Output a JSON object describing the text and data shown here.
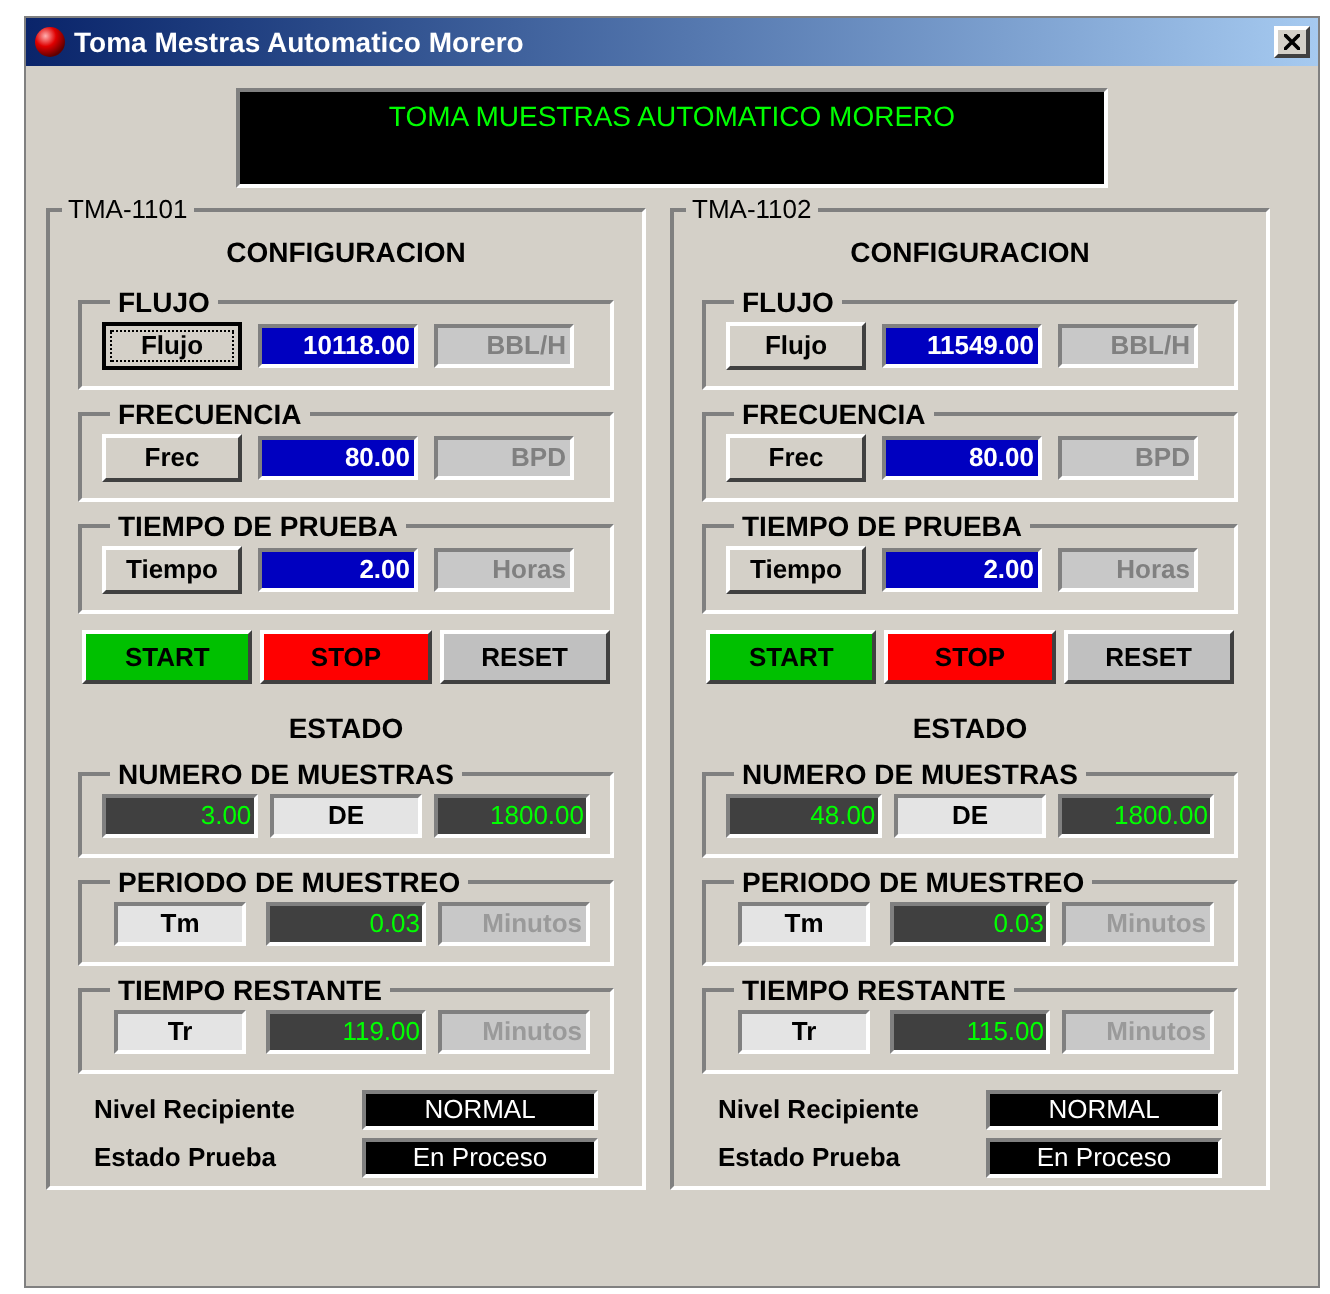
{
  "window": {
    "title": "Toma Mestras Automatico Morero"
  },
  "banner": "TOMA MUESTRAS AUTOMATICO MORERO",
  "panels": [
    {
      "title": "TMA-1101",
      "config_heading": "CONFIGURACION",
      "config_groups": [
        {
          "title": "FLUJO",
          "button": {
            "label": "Flujo",
            "focused": true
          },
          "value": "10118.00",
          "unit": "BBL/H"
        },
        {
          "title": "FRECUENCIA",
          "button": {
            "label": "Frec",
            "focused": false
          },
          "value": "80.00",
          "unit": "BPD"
        },
        {
          "title": "TIEMPO DE PRUEBA",
          "button": {
            "label": "Tiempo",
            "focused": false
          },
          "value": "2.00",
          "unit": "Horas"
        }
      ],
      "actions": [
        {
          "label": "START",
          "kind": "start"
        },
        {
          "label": "STOP",
          "kind": "stop"
        },
        {
          "label": "RESET",
          "kind": "reset"
        }
      ],
      "status_heading": "ESTADO",
      "status_groups": [
        {
          "title": "NUMERO DE MUESTRAS",
          "cells": [
            {
              "text": "3.00",
              "kind": "reading"
            },
            {
              "text": "DE",
              "kind": "label"
            },
            {
              "text": "1800.00",
              "kind": "reading"
            }
          ]
        },
        {
          "title": "PERIODO DE MUESTREO",
          "cells": [
            {
              "text": "Tm",
              "kind": "label"
            },
            {
              "text": "0.03",
              "kind": "reading"
            },
            {
              "text": "Minutos",
              "kind": "unit"
            }
          ]
        },
        {
          "title": "TIEMPO RESTANTE",
          "cells": [
            {
              "text": "Tr",
              "kind": "label"
            },
            {
              "text": "119.00",
              "kind": "reading"
            },
            {
              "text": "Minutos",
              "kind": "unit"
            }
          ]
        }
      ],
      "indicators": [
        {
          "label": "Nivel Recipiente",
          "value": "NORMAL"
        },
        {
          "label": "Estado Prueba",
          "value": "En Proceso"
        }
      ]
    },
    {
      "title": "TMA-1102",
      "config_heading": "CONFIGURACION",
      "config_groups": [
        {
          "title": "FLUJO",
          "button": {
            "label": "Flujo",
            "focused": false
          },
          "value": "11549.00",
          "unit": "BBL/H"
        },
        {
          "title": "FRECUENCIA",
          "button": {
            "label": "Frec",
            "focused": false
          },
          "value": "80.00",
          "unit": "BPD"
        },
        {
          "title": "TIEMPO DE PRUEBA",
          "button": {
            "label": "Tiempo",
            "focused": false
          },
          "value": "2.00",
          "unit": "Horas"
        }
      ],
      "actions": [
        {
          "label": "START",
          "kind": "start"
        },
        {
          "label": "STOP",
          "kind": "stop"
        },
        {
          "label": "RESET",
          "kind": "reset"
        }
      ],
      "status_heading": "ESTADO",
      "status_groups": [
        {
          "title": "NUMERO DE MUESTRAS",
          "cells": [
            {
              "text": "48.00",
              "kind": "reading"
            },
            {
              "text": "DE",
              "kind": "label"
            },
            {
              "text": "1800.00",
              "kind": "reading"
            }
          ]
        },
        {
          "title": "PERIODO DE MUESTREO",
          "cells": [
            {
              "text": "Tm",
              "kind": "label"
            },
            {
              "text": "0.03",
              "kind": "reading"
            },
            {
              "text": "Minutos",
              "kind": "unit"
            }
          ]
        },
        {
          "title": "TIEMPO RESTANTE",
          "cells": [
            {
              "text": "Tr",
              "kind": "label"
            },
            {
              "text": "115.00",
              "kind": "reading"
            },
            {
              "text": "Minutos",
              "kind": "unit"
            }
          ]
        }
      ],
      "indicators": [
        {
          "label": "Nivel Recipiente",
          "value": "NORMAL"
        },
        {
          "label": "Estado Prueba",
          "value": "En Proceso"
        }
      ]
    }
  ]
}
